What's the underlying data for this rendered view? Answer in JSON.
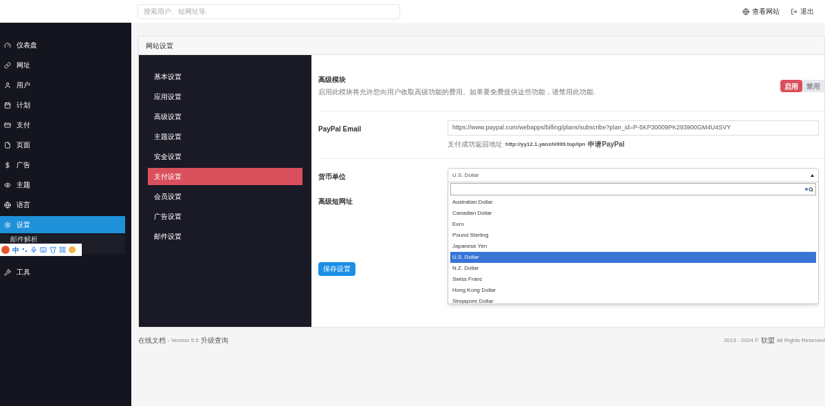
{
  "topbar": {
    "search": {
      "placeholder": "搜索用户、短网址等."
    },
    "links": [
      {
        "label": "查看网站",
        "kind": "globe"
      },
      {
        "label": "退出",
        "kind": "logout"
      }
    ]
  },
  "sidebar": {
    "items": [
      {
        "label": "仪表盘",
        "kind": "gauge",
        "selected": false
      },
      {
        "label": "网址",
        "kind": "link",
        "selected": false
      },
      {
        "label": "用户",
        "kind": "user",
        "selected": false
      },
      {
        "label": "计划",
        "kind": "calendar",
        "selected": false
      },
      {
        "label": "支付",
        "kind": "card",
        "selected": false
      },
      {
        "label": "页面",
        "kind": "file",
        "selected": false
      },
      {
        "label": "广告",
        "kind": "dollar",
        "selected": false
      },
      {
        "label": "主题",
        "kind": "eye",
        "selected": false
      },
      {
        "label": "语言",
        "kind": "globe",
        "selected": false
      },
      {
        "label": "设置",
        "kind": "gear",
        "selected": true,
        "children": [
          {
            "label": "邮件解析"
          }
        ]
      },
      {
        "label": "工具",
        "kind": "wrench",
        "selected": false
      }
    ]
  },
  "ime_toolbar": {
    "mode": "中"
  },
  "panel": {
    "title": "网站设置",
    "tabs": [
      {
        "label": "基本设置",
        "selected": false
      },
      {
        "label": "应用设置",
        "selected": false
      },
      {
        "label": "高级设置",
        "selected": false
      },
      {
        "label": "主题设置",
        "selected": false
      },
      {
        "label": "安全设置",
        "selected": false
      },
      {
        "label": "支付设置",
        "selected": true
      },
      {
        "label": "会员设置",
        "selected": false
      },
      {
        "label": "广告设置",
        "selected": false
      },
      {
        "label": "邮件设置",
        "selected": false
      }
    ],
    "premium": {
      "title": "高级模块",
      "description": "启用此模块将允许您向用户收取高级功能的费用。如果要免费提供这些功能，请禁用此功能.",
      "options": [
        {
          "label": "启用",
          "selected": true
        },
        {
          "label": "禁用",
          "selected": false
        }
      ]
    },
    "paypal": {
      "label": "PayPal Email",
      "value": "https://www.paypal.com/webapps/billing/plans/subscribe?plan_id=P-5KP30009PK293900GM4U4SVY",
      "help": "支付成功返回地址",
      "help_url": "http://yy12.1.yanshi999.top/ipn",
      "help_link": "申请PayPal"
    },
    "currency": {
      "label": "货币单位",
      "value": "U.S. Dollar",
      "options": [
        {
          "label": "Australian Dollar",
          "selected": false
        },
        {
          "label": "Canadian Dollar",
          "selected": false
        },
        {
          "label": "Euro",
          "selected": false
        },
        {
          "label": "Pound Sterling",
          "selected": false
        },
        {
          "label": "Japanese Yen",
          "selected": false
        },
        {
          "label": "U.S. Dollar",
          "selected": true
        },
        {
          "label": "N.Z. Dollar",
          "selected": false
        },
        {
          "label": "Swiss Franc",
          "selected": false
        },
        {
          "label": "Hong Kong Dollar",
          "selected": false
        },
        {
          "label": "Singapore Dollar",
          "selected": false
        }
      ]
    },
    "shortener": {
      "label": "高级短网址"
    },
    "save": "保存设置"
  },
  "footer": {
    "left": "在线文档",
    "version": "- Version 5.5",
    "upgrade": "升级查询",
    "right": "2013 - 2024 ©",
    "brand": "软盟",
    "rights": "All Rights Reserved"
  }
}
